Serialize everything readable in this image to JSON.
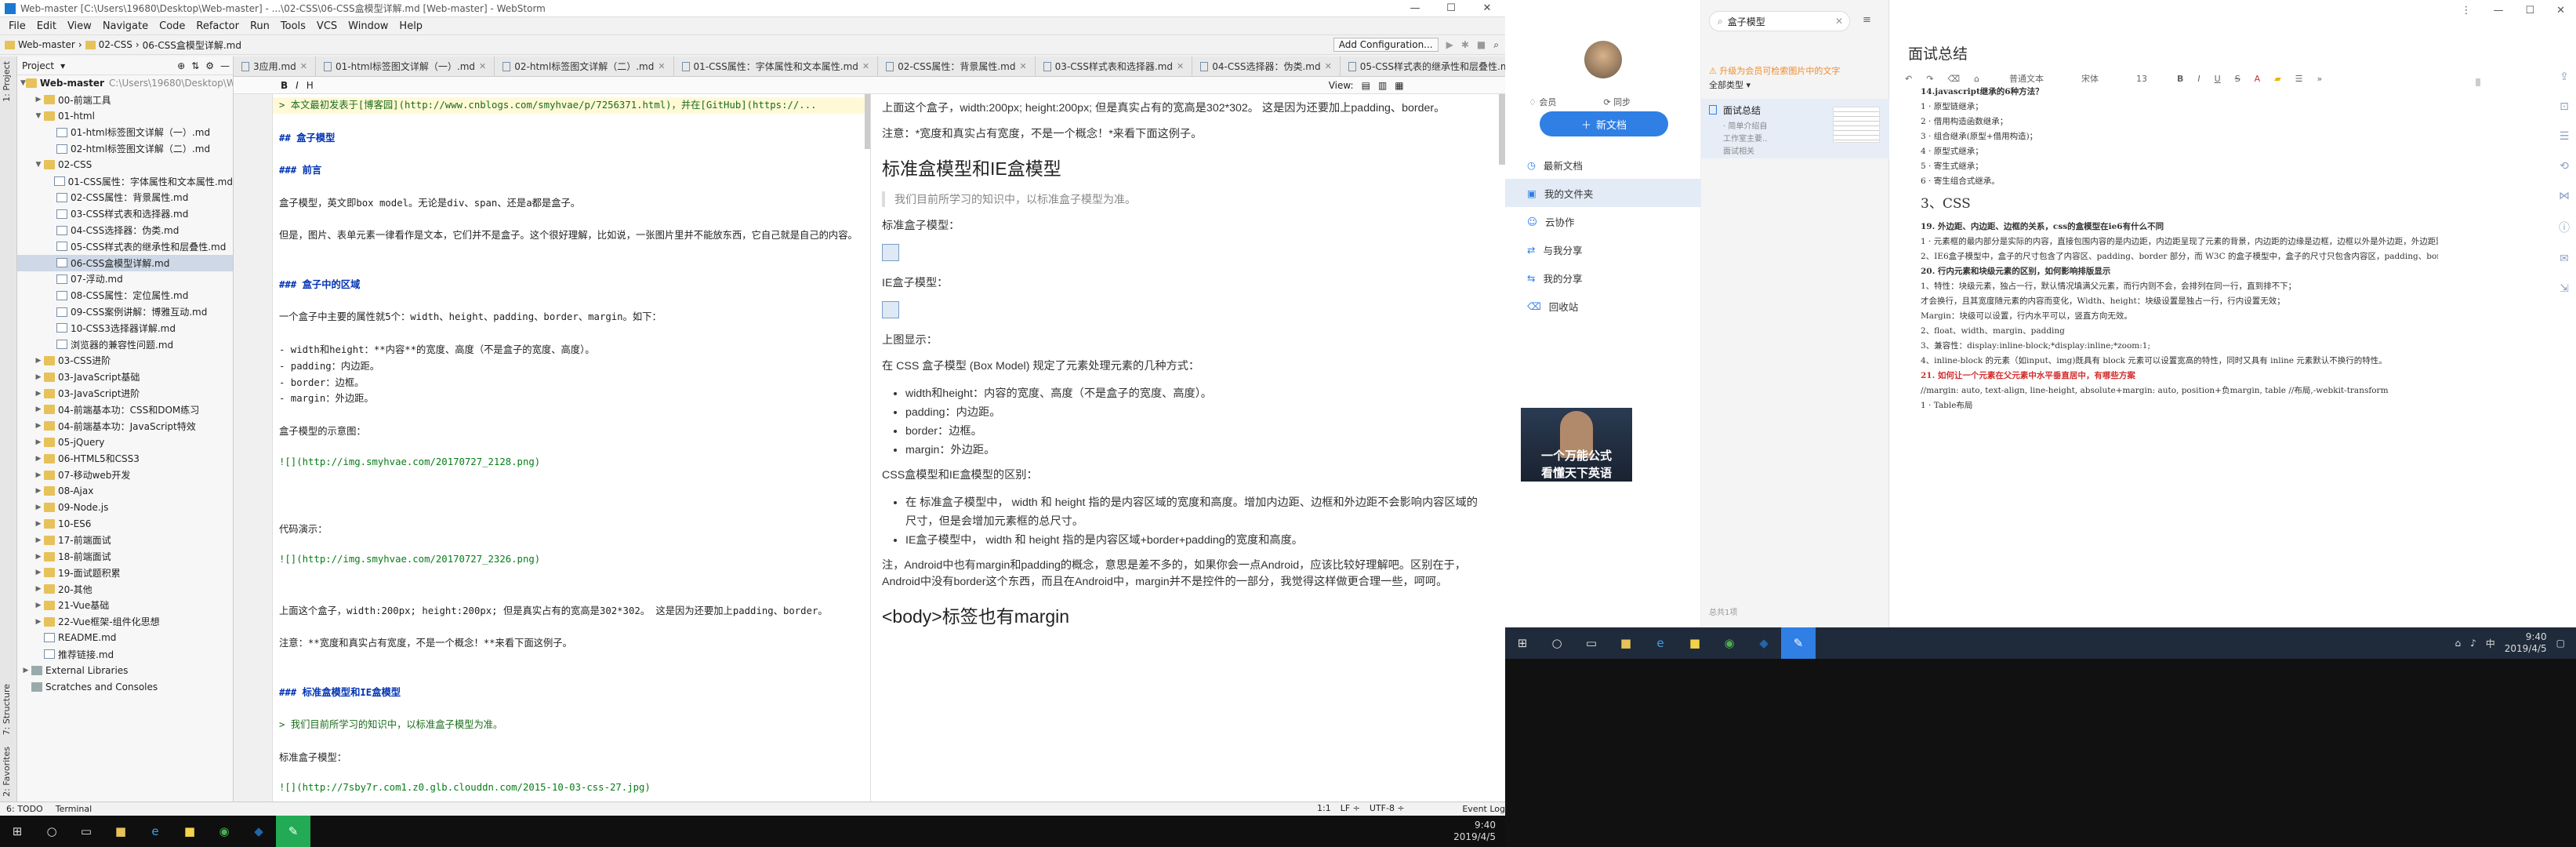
{
  "ws": {
    "title": "Web-master [C:\\Users\\19680\\Desktop\\Web-master] - ...\\02-CSS\\06-CSS盒模型详解.md [Web-master] - WebStorm",
    "menu": [
      "File",
      "Edit",
      "View",
      "Navigate",
      "Code",
      "Refactor",
      "Run",
      "Tools",
      "VCS",
      "Window",
      "Help"
    ],
    "breadcrumbs": [
      "Web-master",
      "02-CSS",
      "06-CSS盒模型详解.md"
    ],
    "add_config": "Add Configuration...",
    "project_label": "Project",
    "tree": [
      {
        "label": "Web-master",
        "extra": "C:\\Users\\19680\\Desktop\\Web-master",
        "kind": "folder",
        "depth": 0,
        "arrow": "▼",
        "bold": true
      },
      {
        "label": "00-前端工具",
        "kind": "folder",
        "depth": 1,
        "arrow": "▶"
      },
      {
        "label": "01-html",
        "kind": "folder",
        "depth": 1,
        "arrow": "▼"
      },
      {
        "label": "01-html标签图文详解（一）.md",
        "kind": "md",
        "depth": 2
      },
      {
        "label": "02-html标签图文详解（二）.md",
        "kind": "md",
        "depth": 2
      },
      {
        "label": "02-CSS",
        "kind": "folder",
        "depth": 1,
        "arrow": "▼"
      },
      {
        "label": "01-CSS属性：字体属性和文本属性.md",
        "kind": "md",
        "depth": 2
      },
      {
        "label": "02-CSS属性：背景属性.md",
        "kind": "md",
        "depth": 2
      },
      {
        "label": "03-CSS样式表和选择器.md",
        "kind": "md",
        "depth": 2
      },
      {
        "label": "04-CSS选择器：伪类.md",
        "kind": "md",
        "depth": 2
      },
      {
        "label": "05-CSS样式表的继承性和层叠性.md",
        "kind": "md",
        "depth": 2
      },
      {
        "label": "06-CSS盒模型详解.md",
        "kind": "md",
        "depth": 2,
        "sel": true
      },
      {
        "label": "07-浮动.md",
        "kind": "md",
        "depth": 2
      },
      {
        "label": "08-CSS属性：定位属性.md",
        "kind": "md",
        "depth": 2
      },
      {
        "label": "09-CSS案例讲解：博雅互动.md",
        "kind": "md",
        "depth": 2
      },
      {
        "label": "10-CSS3选择器详解.md",
        "kind": "md",
        "depth": 2
      },
      {
        "label": "浏览器的兼容性问题.md",
        "kind": "md",
        "depth": 2
      },
      {
        "label": "03-CSS进阶",
        "kind": "folder",
        "depth": 1,
        "arrow": "▶"
      },
      {
        "label": "03-JavaScript基础",
        "kind": "folder",
        "depth": 1,
        "arrow": "▶"
      },
      {
        "label": "03-JavaScript进阶",
        "kind": "folder",
        "depth": 1,
        "arrow": "▶"
      },
      {
        "label": "04-前端基本功：CSS和DOM练习",
        "kind": "folder",
        "depth": 1,
        "arrow": "▶"
      },
      {
        "label": "04-前端基本功：JavaScript特效",
        "kind": "folder",
        "depth": 1,
        "arrow": "▶"
      },
      {
        "label": "05-jQuery",
        "kind": "folder",
        "depth": 1,
        "arrow": "▶"
      },
      {
        "label": "06-HTML5和CSS3",
        "kind": "folder",
        "depth": 1,
        "arrow": "▶"
      },
      {
        "label": "07-移动web开发",
        "kind": "folder",
        "depth": 1,
        "arrow": "▶"
      },
      {
        "label": "08-Ajax",
        "kind": "folder",
        "depth": 1,
        "arrow": "▶"
      },
      {
        "label": "09-Node.js",
        "kind": "folder",
        "depth": 1,
        "arrow": "▶"
      },
      {
        "label": "10-ES6",
        "kind": "folder",
        "depth": 1,
        "arrow": "▶"
      },
      {
        "label": "17-前端面试",
        "kind": "folder",
        "depth": 1,
        "arrow": "▶"
      },
      {
        "label": "18-前端面试",
        "kind": "folder",
        "depth": 1,
        "arrow": "▶"
      },
      {
        "label": "19-面试题积累",
        "kind": "folder",
        "depth": 1,
        "arrow": "▶"
      },
      {
        "label": "20-其他",
        "kind": "folder",
        "depth": 1,
        "arrow": "▶"
      },
      {
        "label": "21-Vue基础",
        "kind": "folder",
        "depth": 1,
        "arrow": "▶"
      },
      {
        "label": "22-Vue框架-组件化思想",
        "kind": "folder",
        "depth": 1,
        "arrow": "▶"
      },
      {
        "label": "README.md",
        "kind": "md",
        "depth": 1
      },
      {
        "label": "推荐链接.md",
        "kind": "md",
        "depth": 1
      },
      {
        "label": "External Libraries",
        "kind": "lib",
        "depth": 0,
        "arrow": "▶"
      },
      {
        "label": "Scratches and Consoles",
        "kind": "lib",
        "depth": 0
      }
    ],
    "tabs": [
      "3应用.md",
      "01-html标签图文详解（一）.md",
      "02-html标签图文详解（二）.md",
      "01-CSS属性：字体属性和文本属性.md",
      "02-CSS属性：背景属性.md",
      "03-CSS样式表和选择器.md",
      "04-CSS选择器：伪类.md",
      "05-CSS样式表的继承性和层叠性.md",
      "06-CSS盒模型详解.md"
    ],
    "view_label": "View:",
    "source_lines": [
      "> 本文最初发表于[博客园](http://www.cnblogs.com/smyhvae/p/7256371.html)，并在[GitHub](https://...",
      "",
      "## 盒子模型",
      "",
      "### 前言",
      "",
      "盒子模型，英文即box model。无论是div、span、还是a都是盒子。",
      "",
      "但是，图片、表单元素一律看作是文本，它们并不是盒子。这个很好理解，比如说，一张图片里并不能放东西，它自己就是自己的内容。",
      "",
      "",
      "### 盒子中的区域",
      "",
      "一个盒子中主要的属性就5个：width、height、padding、border、margin。如下：",
      "",
      "- width和height：**内容**的宽度、高度（不是盒子的宽度、高度）。",
      "- padding：内边距。",
      "- border：边框。",
      "- margin：外边距。",
      "",
      "盒子模型的示意图：",
      "",
      "![](http://img.smyhvae.com/20170727_2128.png)",
      "",
      "",
      "",
      "代码演示：",
      "",
      "![](http://img.smyhvae.com/20170727_2326.png)",
      "",
      "",
      "上面这个盒子，width:200px; height:200px; 但是真实占有的宽高是302*302。 这是因为还要加上padding、border。",
      "",
      "注意：**宽度和真实占有宽度，不是一个概念！**来看下面这例子。",
      "",
      "",
      "### 标准盒模型和IE盒模型",
      "",
      "> 我们目前所学习的知识中，以标准盒子模型为准。",
      "",
      "标准盒子模型：",
      "",
      "![](http://7sby7r.com1.z0.glb.clouddn.com/2015-10-03-css-27.jpg)",
      "",
      "IE盒子模型：",
      "",
      "![](http://7sby7r.com1.z0.glb.clouddn.com/2015-10-03-css-30.jpg)"
    ],
    "preview": {
      "p1": "上面这个盒子，width:200px; height:200px; 但是真实占有的宽高是302*302。 这是因为还要加上padding、border。",
      "p2": "注意：*宽度和真实占有宽度，不是一个概念！*来看下面这例子。",
      "h2": "标准盒模型和IE盒模型",
      "quote": "我们目前所学习的知识中，以标准盒子模型为准。",
      "std": "标准盒子模型：",
      "ie": "IE盒子模型：",
      "shown": "上图显示：",
      "p3": "在 CSS 盒子模型 (Box Model) 规定了元素处理元素的几种方式：",
      "list": [
        "width和height：内容的宽度、高度（不是盒子的宽度、高度）。",
        "padding：内边距。",
        "border：边框。",
        "margin：外边距。"
      ],
      "p4": "CSS盒模型和IE盒模型的区别：",
      "list2": [
        "在 标准盒子模型中， width 和 height 指的是内容区域的宽度和高度。增加内边距、边框和外边距不会影响内容区域的尺寸，但是会增加元素框的总尺寸。",
        "IE盒子模型中， width 和 height 指的是内容区域+border+padding的宽度和高度。"
      ],
      "p5": "注，Android中也有margin和padding的概念，意思是差不多的，如果你会一点Android，应该比较好理解吧。区别在于，Android中没有border这个东西，而且在Android中，margin并不是控件的一部分，我觉得这样做更合理一些，呵呵。",
      "h2b": "<body>标签也有margin"
    },
    "status": {
      "todo": "6: TODO",
      "terminal": "Terminal",
      "event_log": "Event Log",
      "pos": "1:1",
      "lf": "LF ÷",
      "enc": "UTF-8 ÷"
    },
    "clock": {
      "time": "9:40",
      "date": "2019/4/5"
    }
  },
  "note": {
    "member": "会员",
    "sync": "同步",
    "new_doc": "新文档",
    "nav": [
      "最新文档",
      "我的文件夹",
      "云协作",
      "与我分享",
      "我的分享",
      "回收站"
    ],
    "search": "盒子模型",
    "upgrade": "升级为会员可检索图片中的文字",
    "type_filter": "全部类型",
    "result_title": "面试总结",
    "result_lines": [
      "· 简单介绍自",
      "工作室主要..",
      "面试相关"
    ],
    "count": "总共1项",
    "doc_title": "面试总结",
    "font_label": "宋体",
    "size_label": "13",
    "para_label": "普通文本",
    "doc_lines": [
      {
        "t": "14.javascript继承的6种方法？",
        "b": true
      },
      {
        "t": "1 · 原型链继承；"
      },
      {
        "t": "2 · 借用构造函数继承；"
      },
      {
        "t": "3 · 组合继承(原型+借用构造)；"
      },
      {
        "t": "4 · 原型式继承；"
      },
      {
        "t": "5 · 寄生式继承；"
      },
      {
        "t": "6 · 寄生组合式继承。"
      },
      {
        "t": ""
      },
      {
        "t": "3、CSS",
        "h": true
      },
      {
        "t": "    19. 外边距、内边距、边框的关系，css的盒模型在ie6有什么不同",
        "b": true
      },
      {
        "t": "1 · 元素框的最内部分是实际的内容，直接包围内容的是内边距，内边距呈现了元素的背景，内边距的边缘是边框，边框以外是外边距，外边距默认是透明的，因此不会遮挡其后的任何元素。"
      },
      {
        "t": "              2、IE6盒子模型中，盒子的尺寸包含了内容区、padding、border 部分，而 W3C 的盒子模型中，盒子的尺寸只包含内容区，padding、border 和 margin 要单独算盒子尺寸之外。"
      },
      {
        "t": "    20. 行内元素和块级元素的区别，如何影响排版显示",
        "b": true
      },
      {
        "t": "  1、特性：块级元素，独占一行，默认情况填满父元素，而行内则不会，会排列在同一行，直到排不下；"
      },
      {
        "t": "      才会换行，且其宽度随元素的内容而变化，Width、height：块级设置是独占一行，行内设置无效；"
      },
      {
        "t": "      Margin：块级可以设置，行内水平可以，竖直方向无效。"
      },
      {
        "t": "  2、float、width、margin、padding"
      },
      {
        "t": "  3、兼容性：display:inline-block;*display:inline;*zoom:1;"
      },
      {
        "t": "  4、inline-block 的元素（如input、img)既具有 block 元素可以设置宽高的特性，同时又具有 inline 元素默认不换行的特性。"
      },
      {
        "t": "    21. 如何让一个元素在父元素中水平垂直居中，有哪些方案",
        "r": true
      },
      {
        "t": "//margin: auto, text-align, line-height, absolute+margin: auto, position+负margin, table //布局,-webkit-transform"
      },
      {
        "t": "1 · Table布局"
      }
    ],
    "video_caption1": "一个万能公式",
    "video_caption2": "看懂天下英语",
    "clock": {
      "time": "9:40",
      "date": "2019/4/5"
    },
    "tray_lang": "中"
  }
}
